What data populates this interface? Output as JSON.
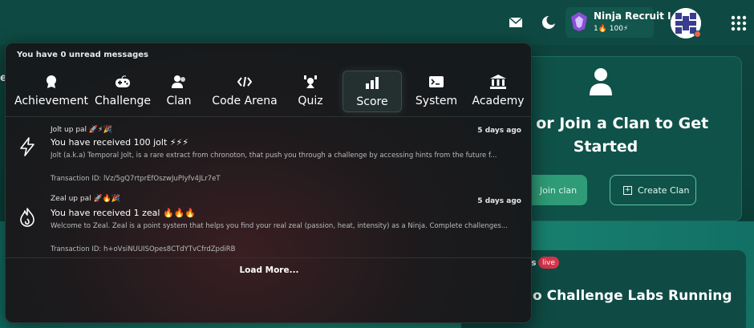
{
  "topbar": {
    "profile": {
      "name": "Ninja Recruit I",
      "stats": "1🔥 100⚡"
    }
  },
  "background": {
    "left_edge_fragment": "e",
    "clan_card": {
      "title": "ate or Join a Clan to Get Started",
      "join_label": "Join clan",
      "create_label": "Create Clan"
    },
    "labs_card": {
      "label_fragment": "s",
      "live_badge": "live",
      "text": "o Challenge Labs Running"
    }
  },
  "notifications": {
    "header": "You have 0 unread messages",
    "tabs": [
      {
        "label": "Achievement",
        "icon": "medal-icon"
      },
      {
        "label": "Challenge",
        "icon": "gamepad-icon"
      },
      {
        "label": "Clan",
        "icon": "users-icon"
      },
      {
        "label": "Code Arena",
        "icon": "code-icon"
      },
      {
        "label": "Quiz",
        "icon": "quiz-icon"
      },
      {
        "label": "Score",
        "icon": "bar-chart-icon",
        "active": true
      },
      {
        "label": "System",
        "icon": "terminal-icon"
      },
      {
        "label": "Academy",
        "icon": "building-columns-icon"
      }
    ],
    "messages": [
      {
        "icon": "lightning-icon",
        "sender": "Jolt up pal 🚀⚡🎉",
        "time": "5 days ago",
        "title": "You have received 100 jolt ⚡⚡⚡",
        "body": "Jolt (a.k.a) Temporal Jolt, is a rare extract from chronoton, that push you through a challenge by accessing hints from the future f...",
        "transaction": "Transaction ID: lVz/5gQ7rtprEfOszwJuPIyfv4JLr7eT"
      },
      {
        "icon": "flame-icon",
        "sender": "Zeal up pal 🚀🔥🎉",
        "time": "5 days ago",
        "title": "You have received 1 zeal 🔥🔥🔥",
        "body": "Welcome to Zeal. Zeal is a point system that helps you find your real zeal (passion, heat, intensity) as a Ninja. Complete challenges...",
        "transaction": "Transaction ID: h+oVsiNUUISOpes8CTdYTvCfrdZpdiRB"
      }
    ],
    "load_more": "Load More..."
  }
}
